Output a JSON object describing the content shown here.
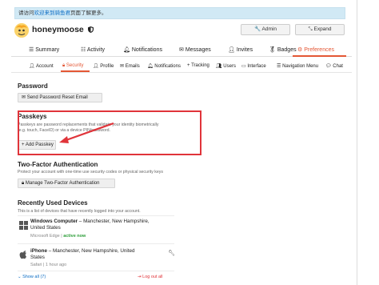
{
  "notice": {
    "prefix": "请访问",
    "link": "欢迎来到骑鱼君",
    "suffix": "页面了解更多。"
  },
  "user": {
    "name": "honeymoose"
  },
  "header_buttons": {
    "admin": "Admin",
    "expand": "Expand"
  },
  "nav_primary": [
    "Summary",
    "Activity",
    "Notifications",
    "Messages",
    "Invites",
    "Badges",
    "Preferences"
  ],
  "nav_secondary": [
    "Account",
    "Security",
    "Profile",
    "Emails",
    "Notifications",
    "Tracking",
    "Users",
    "Interface",
    "Navigation Menu",
    "Chat"
  ],
  "password": {
    "title": "Password",
    "button": "Send Password Reset Email"
  },
  "passkeys": {
    "title": "Passkeys",
    "desc_line1": "Passkeys are password replacements that validate your identity biometrically",
    "desc_line2": "(e.g. touch, FaceID) or via a device PIN/password.",
    "button": "Add Passkey"
  },
  "tfa": {
    "title": "Two-Factor Authentication",
    "desc": "Protect your account with one-time use security codes or physical security keys",
    "button": "Manage Two-Factor Authentication"
  },
  "devices": {
    "title": "Recently Used Devices",
    "desc": "This is a list of devices that have recently logged into your account.",
    "items": [
      {
        "name": "Windows Computer",
        "loc_line1": " – Manchester, New Hampshire,",
        "loc_line2": "United States",
        "browser": "Microsoft Edge",
        "sep": " | ",
        "status": "active now"
      },
      {
        "name": "iPhone",
        "loc_line1": " – Manchester, New Hampshire, United",
        "loc_line2": "States",
        "browser": "Safari",
        "sep": " | ",
        "status": "1 hour ago"
      }
    ],
    "show_all": "Show all (7)",
    "log_out_all": "Log out all"
  },
  "colors": {
    "accent": "#e45735",
    "annotation": "#e0343a",
    "link": "#0a6cc4",
    "active": "#2e9e3a"
  }
}
